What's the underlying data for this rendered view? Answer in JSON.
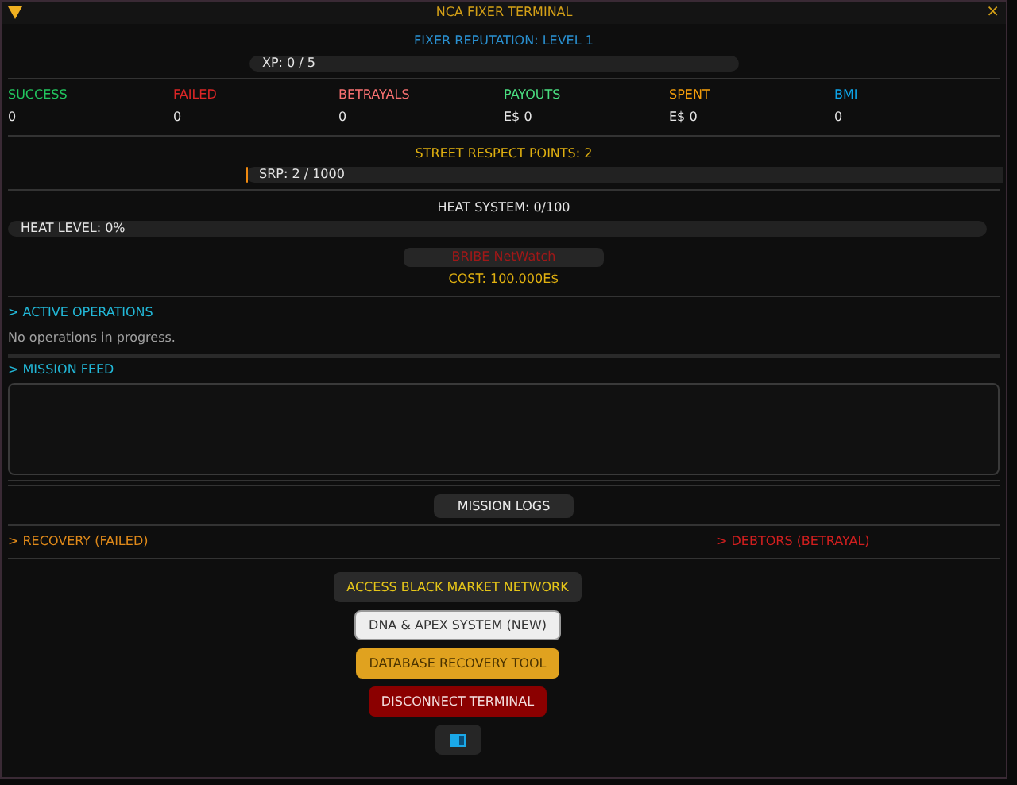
{
  "window": {
    "title": "NCA FIXER TERMINAL",
    "close": "×"
  },
  "reputation": {
    "title": "FIXER REPUTATION: LEVEL 1",
    "bar_label": "XP: 0 / 5",
    "level": 0
  },
  "stats": [
    {
      "label": "SUCCESS",
      "value": "0",
      "color": "#22c55e"
    },
    {
      "label": "FAILED",
      "value": "0",
      "color": "#dc2626"
    },
    {
      "label": "BETRAYALS",
      "value": "0",
      "color": "#f87171"
    },
    {
      "label": "PAYOUTS",
      "value": "E$ 0",
      "color": "#4ade80"
    },
    {
      "label": "SPENT",
      "value": "E$ 0",
      "color": "#f59e0b"
    },
    {
      "label": "BMI",
      "value": "0",
      "color": "#0ea5e9"
    }
  ],
  "street_respect": {
    "title": "STREET RESPECT POINTS: 2",
    "bar_label": "SRP: 2 / 1000",
    "level": 0.002
  },
  "heat": {
    "title": "HEAT SYSTEM: 0/100",
    "bar_label": "HEAT LEVEL: 0%",
    "level": 0,
    "bribe_button": "BRIBE NetWatch",
    "cost": "COST: 100.000E$"
  },
  "active_operations": {
    "title": "> ACTIVE OPERATIONS",
    "empty_text": "No operations in progress."
  },
  "mission_feed": {
    "title": "> MISSION FEED"
  },
  "mission_logs_button": "MISSION LOGS",
  "recovery": {
    "title": "> RECOVERY (FAILED)"
  },
  "debtors": {
    "title": "> DEBTORS (BETRAYAL)"
  },
  "actions": [
    {
      "label": "ACCESS BLACK MARKET NETWORK",
      "kind": "dark"
    },
    {
      "label": "DNA & APEX SYSTEM (NEW)",
      "kind": "light"
    },
    {
      "label": "DATABASE RECOVERY TOOL",
      "kind": "amber"
    },
    {
      "label": "DISCONNECT TERMINAL",
      "kind": "red"
    }
  ]
}
